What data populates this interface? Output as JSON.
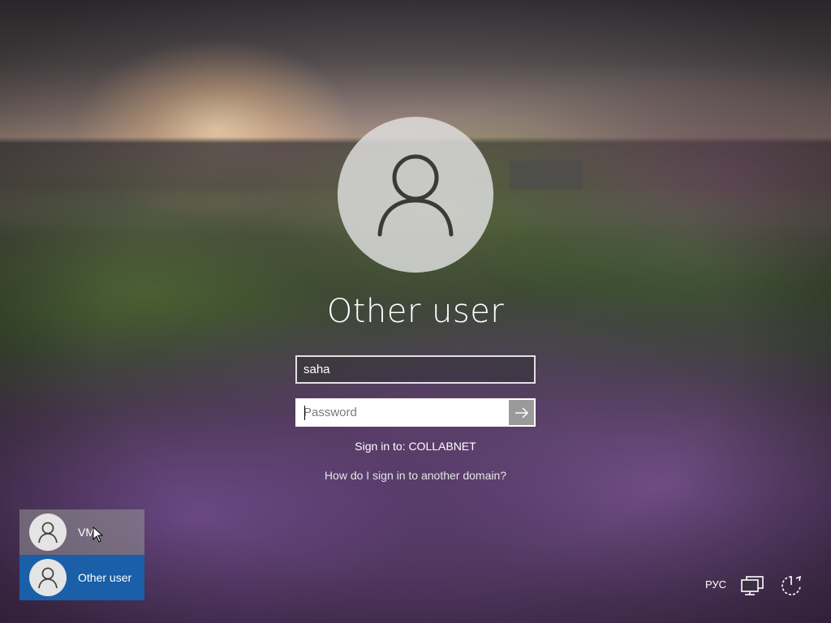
{
  "login": {
    "heading": "Other user",
    "username_value": "saha",
    "password_placeholder": "Password",
    "sign_in_to": "Sign in to: COLLABNET",
    "help_link": "How do I sign in to another domain?",
    "submit_icon": "arrow-right-icon"
  },
  "user_list": [
    {
      "label": "VM",
      "selected": false,
      "icon": "user-icon"
    },
    {
      "label": "Other user",
      "selected": true,
      "icon": "user-icon"
    }
  ],
  "tray": {
    "language": "РУС",
    "network_icon": "network-icon",
    "power_icon": "power-icon"
  },
  "colors": {
    "selected_tile": "#1a5fa8",
    "text": "#ffffff"
  }
}
